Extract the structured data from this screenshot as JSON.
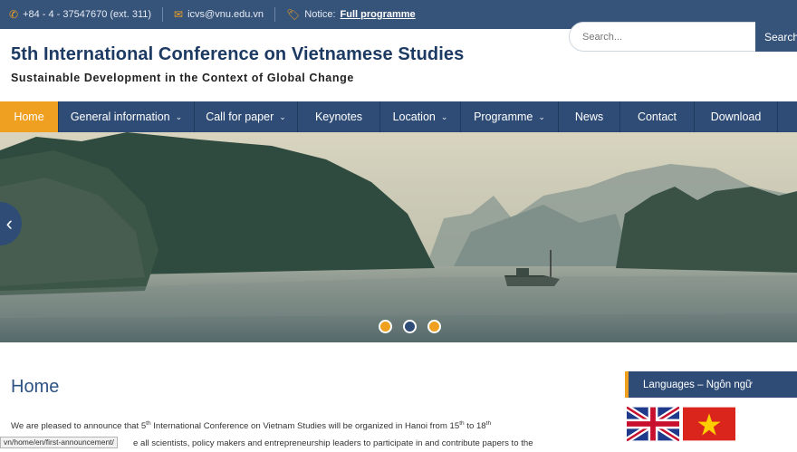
{
  "topbar": {
    "phone": "+84 - 4 - 37547670 (ext. 311)",
    "email": "icvs@vnu.edu.vn",
    "notice_label": "Notice:",
    "notice_link": "Full programme"
  },
  "header": {
    "title": "5th International Conference on Vietnamese Studies",
    "subtitle": "Sustainable Development in the Context of Global Change"
  },
  "search": {
    "placeholder": "Search...",
    "button_label": "Search"
  },
  "nav": [
    {
      "label": "Home",
      "active": true,
      "dropdown": false
    },
    {
      "label": "General information",
      "active": false,
      "dropdown": true
    },
    {
      "label": "Call for paper",
      "active": false,
      "dropdown": true
    },
    {
      "label": "Keynotes",
      "active": false,
      "dropdown": false
    },
    {
      "label": "Location",
      "active": false,
      "dropdown": true
    },
    {
      "label": "Programme",
      "active": false,
      "dropdown": true
    },
    {
      "label": "News",
      "active": false,
      "dropdown": false
    },
    {
      "label": "Contact",
      "active": false,
      "dropdown": false
    },
    {
      "label": "Download",
      "active": false,
      "dropdown": false
    }
  ],
  "slider": {
    "dots": 3,
    "active_dot": 2,
    "prev_icon": "chevron-left-icon"
  },
  "main": {
    "heading": "Home",
    "intro_a": "We are pleased to announce that 5",
    "intro_sup1": "th",
    "intro_b": " International Conference on Vietnam Studies will be organized in Hanoi from 15",
    "intro_sup2": "th",
    "intro_c": " to 18",
    "intro_sup3": "th",
    "intro_d": "e all scientists, policy makers and entrepreneurship leaders to participate in and contribute papers to the"
  },
  "status_bar": "vn/home/en/first-announcement/",
  "sidebar": {
    "languages_title": "Languages – Ngôn ngữ",
    "flags": [
      "uk-flag-icon",
      "vietnam-flag-icon"
    ]
  },
  "colors": {
    "primary": "#2e4c76",
    "accent": "#f0a020",
    "title": "#1d3a63"
  }
}
